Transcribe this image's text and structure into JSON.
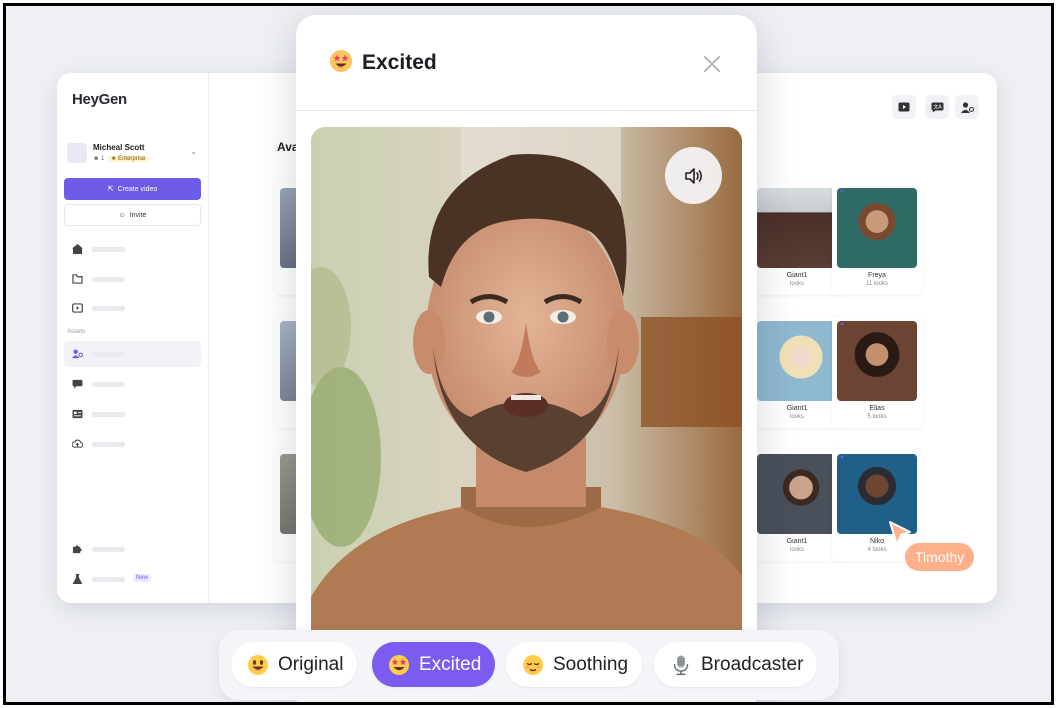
{
  "app": {
    "logo": "HeyGen",
    "user_name": "Micheal Scott",
    "user_members": "1",
    "user_plan": "Enterprise",
    "create_video_label": "Create video",
    "invite_label": "Invite",
    "assets_label": "Assets",
    "new_badge": "New",
    "section_title": "Ava",
    "nav_icons": [
      "home-icon",
      "folder-icon",
      "video-icon",
      "avatar-icon",
      "chat-icon",
      "card-icon",
      "upload-icon",
      "puzzle-icon",
      "flask-icon"
    ]
  },
  "cards": [
    {
      "name": "Giant1",
      "looks": "looks",
      "color": "#5a3d33"
    },
    {
      "name": "Freya",
      "looks": "11 looks",
      "color": "#2f6b66"
    },
    {
      "name": "Giant1",
      "looks": "looks",
      "color": "#8fb9cf"
    },
    {
      "name": "Elias",
      "looks": "5 looks",
      "color": "#6b4433"
    },
    {
      "name": "Giant1",
      "looks": "looks",
      "color": "#4a505a"
    },
    {
      "name": "Niko",
      "looks": "4 looks",
      "color": "#1f5f88"
    }
  ],
  "modal": {
    "title": "Excited",
    "close_icon": "close-icon",
    "sound_icon": "speaker-icon"
  },
  "cursor_tag": "Timothy",
  "tones": [
    {
      "label": "Original",
      "active": false,
      "icon": "grinning-face-icon"
    },
    {
      "label": "Excited",
      "active": true,
      "icon": "star-struck-face-icon"
    },
    {
      "label": "Soothing",
      "active": false,
      "icon": "relieved-face-icon"
    },
    {
      "label": "Broadcaster",
      "active": false,
      "icon": "microphone-icon"
    }
  ],
  "colors": {
    "accent": "#7c5cf0",
    "cursor_tag": "#ffb08a"
  }
}
